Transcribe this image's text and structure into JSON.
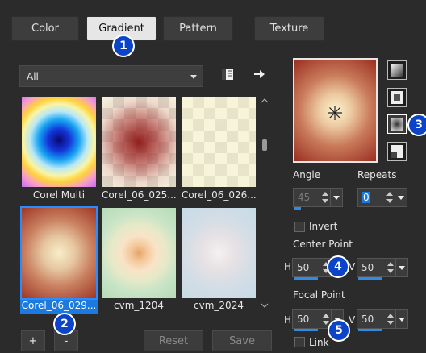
{
  "tabs": [
    {
      "label": "Color"
    },
    {
      "label": "Gradient"
    },
    {
      "label": "Pattern"
    },
    {
      "label": "Texture"
    }
  ],
  "badges": [
    "1",
    "2",
    "3",
    "4",
    "5"
  ],
  "filter": {
    "selected": "All"
  },
  "icons": {
    "library": "book-icon",
    "export": "arrow-right-icon",
    "center_marker": "asterisk-icon",
    "style_linear": "linear-style-icon",
    "style_rectangular": "rectangular-style-icon",
    "style_radial": "radial-style-icon",
    "style_corner": "corner-style-icon"
  },
  "gradients": [
    {
      "label": "Corel Multi"
    },
    {
      "label": "Corel_06_025..."
    },
    {
      "label": "Corel_06_026..."
    },
    {
      "label": "Corel_06_029..."
    },
    {
      "label": "cvm_1204"
    },
    {
      "label": "cvm_2024"
    }
  ],
  "buttons": {
    "add": "+",
    "remove": "-",
    "reset": "Reset",
    "save": "Save"
  },
  "settings": {
    "angle_label": "Angle",
    "angle_value": "45",
    "repeats_label": "Repeats",
    "repeats_value": "0",
    "invert_label": "Invert",
    "center_label": "Center Point",
    "center_h_prefix": "H",
    "center_h": "50",
    "center_v": "50",
    "focal_label": "Focal Point",
    "focal_h_prefix": "H",
    "focal_h": "50",
    "focal_v": "50",
    "v_prefix": "V",
    "link_label": "Link"
  },
  "colors": {
    "accent": "#1a7ae0",
    "badge": "#0b44c9",
    "background": "#2b2b2b"
  }
}
